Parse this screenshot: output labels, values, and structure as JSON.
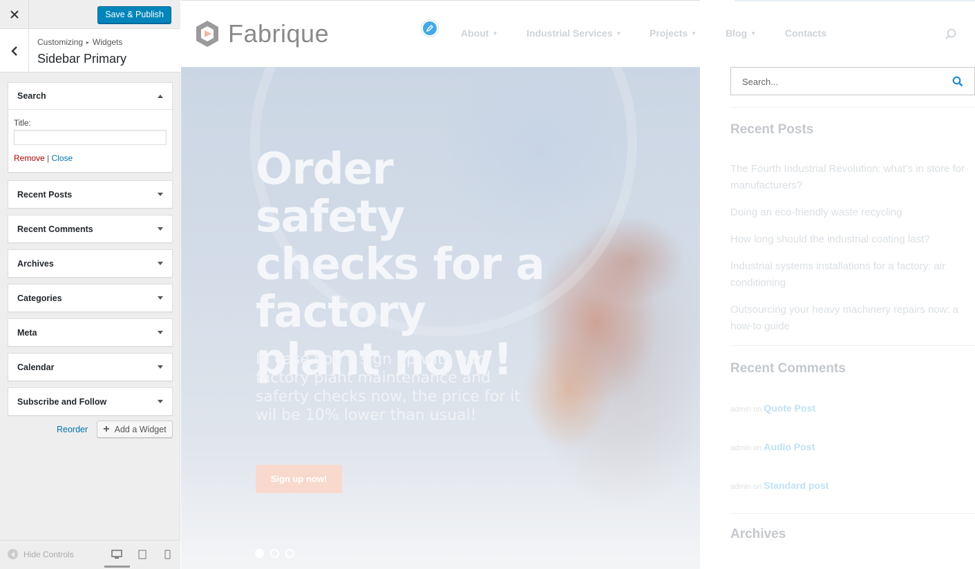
{
  "panel": {
    "save_label": "Save & Publish",
    "breadcrumb_root": "Customizing",
    "breadcrumb_current": "Widgets",
    "section_title": "Sidebar Primary",
    "search_widget": {
      "title": "Search",
      "title_label": "Title:",
      "title_value": "",
      "remove_label": "Remove",
      "separator": "|",
      "close_label": "Close"
    },
    "widgets": [
      "Recent Posts",
      "Recent Comments",
      "Archives",
      "Categories",
      "Meta",
      "Calendar",
      "Subscribe and Follow"
    ],
    "reorder_label": "Reorder",
    "add_widget_label": "Add a Widget",
    "hide_controls_label": "Hide Controls",
    "accent_color": "#0085ba"
  },
  "preview": {
    "logo_text": "Fabrique",
    "nav": [
      "About",
      "Industrial Services",
      "Projects",
      "Blog",
      "Contacts"
    ],
    "hero": {
      "title": "Order safety checks for a factory plant now!",
      "subtitle": "In case you’ll sign up with our factory plant maintenance and saferty checks now, the price for it wil be 10% lower than usual!",
      "button_label": "Sign up now!",
      "slides": 3,
      "active_slide": 1
    },
    "sidebar": {
      "search_placeholder": "Search...",
      "recent_posts_heading": "Recent Posts",
      "recent_posts": [
        "The Fourth Industrial Revolution: what’s in store for manufacturers?",
        "Doing an eco-friendly waste recycling",
        "How long should the industrial coating last?",
        "Industrial systems installations for a factory: air conditioning",
        "Outsourcing your heavy machinery repairs now: a how-to guide"
      ],
      "recent_comments_heading": "Recent Comments",
      "recent_comments": [
        {
          "author": "admin",
          "on": "on",
          "post": "Quote Post"
        },
        {
          "author": "admin",
          "on": "on",
          "post": "Audio Post"
        },
        {
          "author": "admin",
          "on": "on",
          "post": "Standard post"
        }
      ],
      "archives_heading": "Archives"
    }
  }
}
